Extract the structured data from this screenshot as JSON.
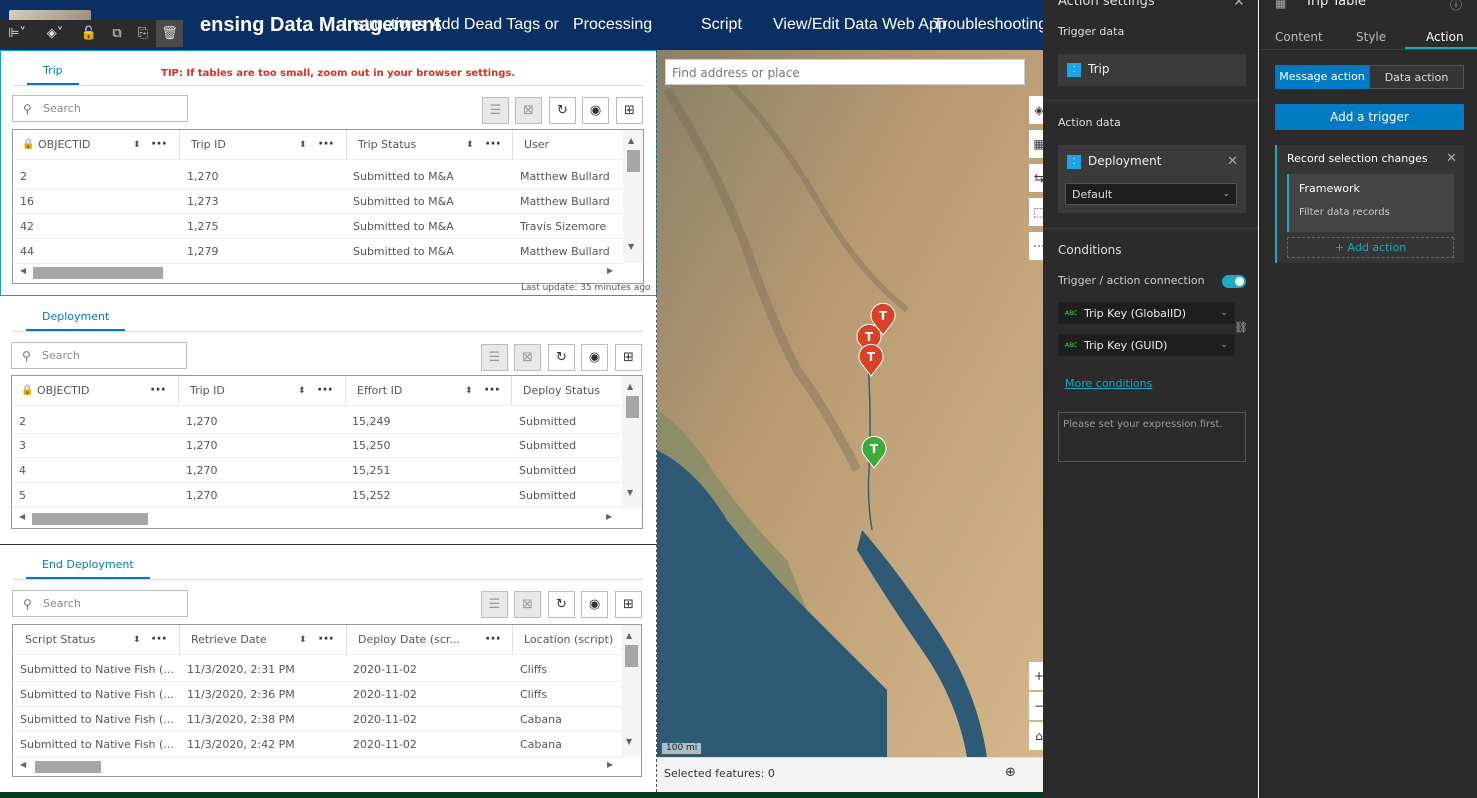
{
  "header": {
    "title": "ensing Data Management",
    "nav": [
      "Instructions",
      "Add Dead Tags or",
      "Processing",
      "Script",
      "View/Edit Data Web App",
      "Troubleshooting"
    ]
  },
  "trip": {
    "tab": "Trip",
    "tip": "TIP: If tables are too small, zoom out in your browser settings.",
    "search_placeholder": "Search",
    "columns": [
      "OBJECTID",
      "Trip ID",
      "Trip Status",
      "User"
    ],
    "rows": [
      [
        "2",
        "1,270",
        "Submitted to M&A",
        "Matthew Bullard"
      ],
      [
        "16",
        "1,273",
        "Submitted to M&A",
        "Matthew Bullard"
      ],
      [
        "42",
        "1,275",
        "Submitted to M&A",
        "Travis Sizemore"
      ],
      [
        "44",
        "1,279",
        "Submitted to M&A",
        "Matthew Bullard"
      ]
    ],
    "last_update": "Last update: 35 minutes ago"
  },
  "deployment": {
    "tab": "Deployment",
    "search_placeholder": "Search",
    "columns": [
      "OBJECTID",
      "Trip ID",
      "Effort ID",
      "Deploy Status"
    ],
    "rows": [
      [
        "2",
        "1,270",
        "15,249",
        "Submitted"
      ],
      [
        "3",
        "1,270",
        "15,250",
        "Submitted"
      ],
      [
        "4",
        "1,270",
        "15,251",
        "Submitted"
      ],
      [
        "5",
        "1,270",
        "15,252",
        "Submitted"
      ]
    ]
  },
  "end_deployment": {
    "tab": "End Deployment",
    "search_placeholder": "Search",
    "columns": [
      "Script Status",
      "Retrieve Date",
      "Deploy Date (scr...",
      "Location (script)"
    ],
    "rows": [
      [
        "Submitted to Native Fish (...",
        "11/3/2020, 2:31 PM",
        "2020-11-02",
        "Cliffs"
      ],
      [
        "Submitted to Native Fish (...",
        "11/3/2020, 2:36 PM",
        "2020-11-02",
        "Cliffs"
      ],
      [
        "Submitted to Native Fish (...",
        "11/3/2020, 2:38 PM",
        "2020-11-02",
        "Cabana"
      ],
      [
        "Submitted to Native Fish (...",
        "11/3/2020, 2:42 PM",
        "2020-11-02",
        "Cabana"
      ]
    ]
  },
  "map": {
    "search_placeholder": "Find address or place",
    "scale": "100 mi",
    "selected_features": "Selected features: 0",
    "pin_letter": "T",
    "colors": {
      "red_pin": "#d8412a",
      "green_pin": "#3daa3a"
    }
  },
  "action_settings": {
    "title": "Action settings",
    "trigger_data_label": "Trigger data",
    "trigger_data": "Trip",
    "action_data_label": "Action data",
    "action_data": "Deployment",
    "view_select": "Default",
    "conditions_label": "Conditions",
    "connection_label": "Trigger / action connection",
    "connection_on": true,
    "trigger_field": "Trip Key (GlobalID)",
    "action_field": "Trip Key (GUID)",
    "more_conditions": "More conditions",
    "expression_placeholder": "Please set your expression first."
  },
  "right_panel": {
    "title": "Trip Table",
    "tabs": [
      "Content",
      "Style",
      "Action"
    ],
    "active_tab": "Action",
    "segments": [
      "Message action",
      "Data action"
    ],
    "active_segment": "Message action",
    "add_trigger": "Add a trigger",
    "record_selection": "Record selection changes",
    "framework": "Framework",
    "filter": "Filter data records",
    "add_action": "+ Add action"
  }
}
